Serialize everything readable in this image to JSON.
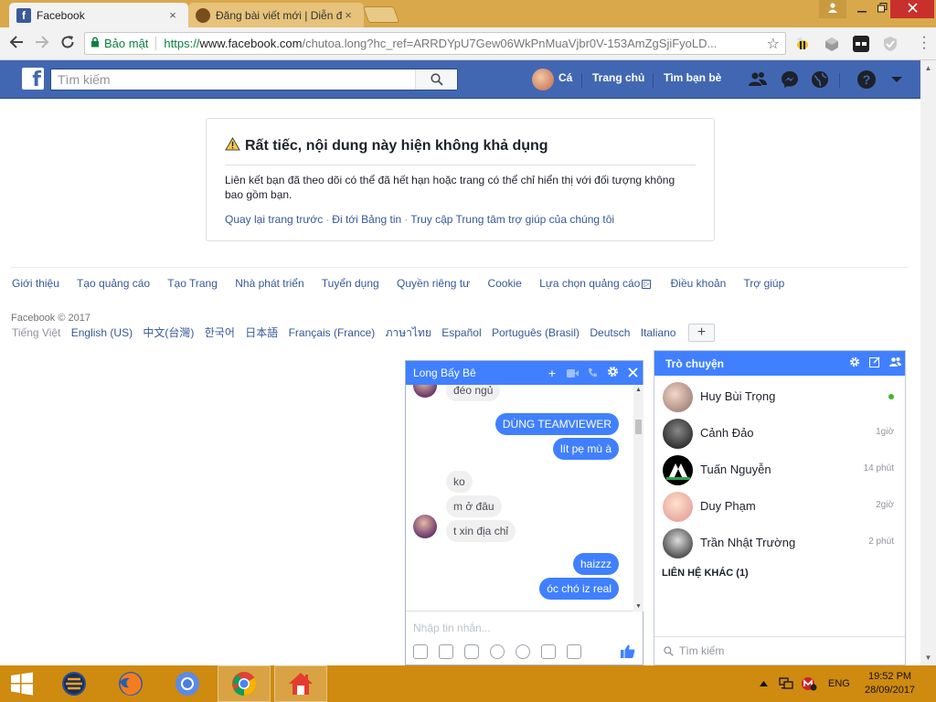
{
  "browser": {
    "tabs": [
      {
        "title": "Facebook",
        "active": true
      },
      {
        "title": "Đăng bài viết mới | Diễn đ",
        "active": false
      }
    ],
    "close_glyph": "×",
    "security_label": "Bảo mật",
    "url_scheme": "https://",
    "url_host": "www.facebook.com",
    "url_path": "/chutoa.long?hc_ref=ARRDYpU7Gew06WkPnMuaVjbr0V-153AmZgSjiFyoLD..."
  },
  "fb_header": {
    "search_placeholder": "Tìm kiếm",
    "profile_name": "Cá",
    "nav_home": "Trang chủ",
    "nav_find_friends": "Tìm bạn bè",
    "help": "?"
  },
  "error_card": {
    "title": "Rất tiếc, nội dung này hiện không khả dụng",
    "body": "Liên kết bạn đã theo dõi có thể đã hết hạn hoặc trang có thể chỉ hiển thị với đối tượng không bao gồm bạn.",
    "links": [
      "Quay lại trang trước",
      "Đi tới Bảng tin",
      "Truy cập Trung tâm trợ giúp của chúng tôi"
    ]
  },
  "footer": {
    "links": [
      "Giới thiệu",
      "Tạo quảng cáo",
      "Tạo Trang",
      "Nhà phát triển",
      "Tuyển dụng",
      "Quyền riêng tư",
      "Cookie",
      "Lựa chọn quảng cáo",
      "Điều khoản",
      "Trợ giúp"
    ],
    "copyright": "Facebook © 2017",
    "current_language": "Tiếng Việt",
    "languages": [
      "English (US)",
      "中文(台灣)",
      "한국어",
      "日本語",
      "Français (France)",
      "ภาษาไทย",
      "Español",
      "Português (Brasil)",
      "Deutsch",
      "Italiano"
    ],
    "more_languages": "+"
  },
  "chat_window": {
    "contact_name": "Long Bấy Bê",
    "messages": [
      {
        "text": "đéo ngủ",
        "dir": "in"
      },
      {
        "text": "DÙNG TEAMVIEWER",
        "dir": "out"
      },
      {
        "text": "lít pẹ mù à",
        "dir": "out"
      },
      {
        "text": "ko",
        "dir": "in"
      },
      {
        "text": "m ở đâu",
        "dir": "in"
      },
      {
        "text": "t xin địa chỉ",
        "dir": "in"
      },
      {
        "text": "haizzz",
        "dir": "out"
      },
      {
        "text": "óc chó iz real",
        "dir": "out"
      }
    ],
    "input_placeholder": "Nhập tin nhắn..."
  },
  "chat_sidebar": {
    "title": "Trò chuyện",
    "contacts": [
      {
        "name": "Huy Bùi Trọng",
        "time": "",
        "online": true
      },
      {
        "name": "Cảnh Đảo",
        "time": "1giờ",
        "online": false
      },
      {
        "name": "Tuấn Nguyễn",
        "time": "14 phút",
        "online": false
      },
      {
        "name": "Duy Phạm",
        "time": "2giờ",
        "online": false
      },
      {
        "name": "Trần Nhật Trường",
        "time": "2 phút",
        "online": false
      }
    ],
    "other_contacts": "LIÊN HỆ KHÁC (1)",
    "search_placeholder": "Tìm kiếm"
  },
  "taskbar": {
    "language": "ENG",
    "time": "19:52 PM",
    "date": "28/09/2017"
  },
  "colors": {
    "fb_blue": "#4267b2",
    "messenger_blue": "#4080ff",
    "link_blue": "#365899",
    "taskbar": "#cf8a10",
    "online_green": "#42b72a"
  }
}
